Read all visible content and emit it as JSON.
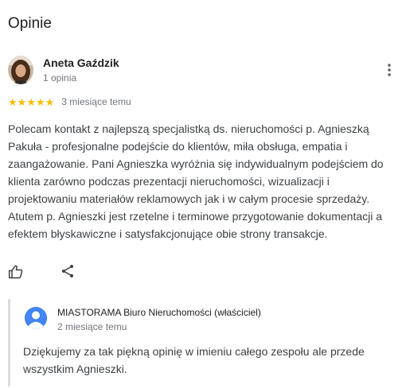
{
  "section": {
    "title": "Opinie"
  },
  "review": {
    "author_name": "Aneta Gaździk",
    "author_meta": "1 opinia",
    "rating": 5,
    "rating_max": 5,
    "stars": [
      "★",
      "★",
      "★",
      "★",
      "★"
    ],
    "date": "3 miesiące temu",
    "text": "Polecam kontakt z najlepszą specjalistką ds. nieruchomości p. Agnieszką\nPakuła - profesjonalne podejście do klientów, miła obsługa, empatia i\nzaangażowanie. Pani Agnieszka wyróżnia się indywidualnym podejściem do\nklienta zarówno podczas prezentacji nieruchomości, wizualizacji i\nprojektowaniu materiałów reklamowych jak i w całym procesie sprzedaży.\nAtutem p. Agnieszki jest rzetelne i terminowe przygotowanie dokumentacji a\nefektem błyskawiczne i satysfakcjonujące obie strony transakcje.",
    "actions": {
      "like_icon": "thumb-up-icon",
      "share_icon": "share-icon",
      "more_icon": "more-vert-icon"
    }
  },
  "owner_reply": {
    "author": "MIASTORAMA Biuro Nieruchomości (właściciel)",
    "date": "2 miesiące temu",
    "text": "Dziękujemy za tak piękną opinię w imieniu całego zespołu ale przede\nwszystkim Agnieszki.",
    "avatar_icon": "person-icon"
  },
  "colors": {
    "star": "#fbbc04",
    "owner_avatar": "#4285f4",
    "secondary_text": "#70757a",
    "body_text": "#3c4043",
    "reply_bar": "#dadce0"
  }
}
